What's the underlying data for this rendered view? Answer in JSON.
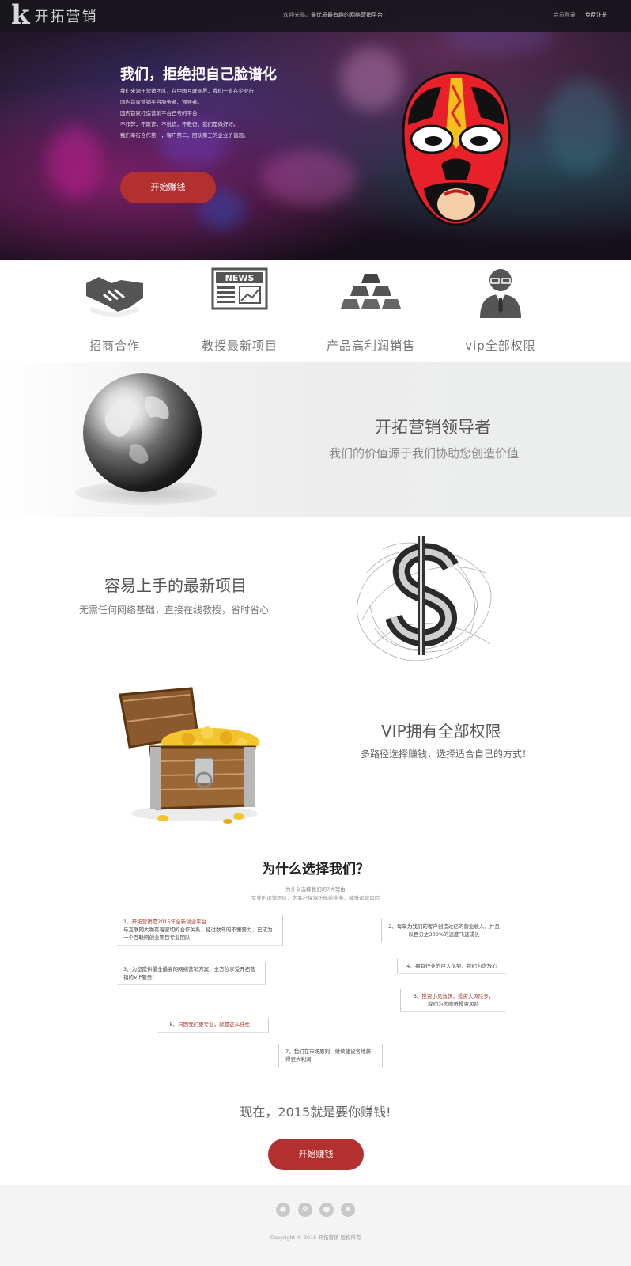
{
  "header": {
    "logo_letter": "k",
    "logo_text": "开拓营销",
    "welcome_prefix": "欢迎光临，",
    "welcome_text": "最优质最有趣的网络营销平台！",
    "login_label": "会员登录",
    "register_label": "免费注册"
  },
  "hero": {
    "title": "我们，拒绝把自己脸谱化",
    "lines": [
      "我们来源于营销团队，在中国互联网界，我们一直在企业行",
      "国内首家营销平台服务者、领导者。",
      "国内首家打造营销平台已号的平台",
      "不作弊，不欺诈，不说谎，不敷衍，我们是做好好。",
      "我们奉行合作第一，客户第二，团队第三的企业价值观。"
    ],
    "button": "开始赚钱"
  },
  "features": [
    {
      "label": "招商合作",
      "icon": "handshake-icon"
    },
    {
      "label": "教授最新项目",
      "icon": "news-icon",
      "icon_text": "NEWS"
    },
    {
      "label": "产品高利润销售",
      "icon": "gold-bars-icon"
    },
    {
      "label": "vip全部权限",
      "icon": "businessman-icon"
    }
  ],
  "leader": {
    "title": "开拓营销领导者",
    "subtitle": "我们的价值源于我们协助您创造价值"
  },
  "easy": {
    "title": "容易上手的最新项目",
    "subtitle": "无需任何网络基础，直接在线教授，省时省心"
  },
  "vip": {
    "title": "VIP拥有全部权限",
    "subtitle": "多路径选择赚钱，选择适合自己的方式！"
  },
  "why": {
    "title": "为什么选择我们？",
    "subtitle1": "为什么选择我们的7大理由",
    "subtitle2": "专业的运营团队，为客户保驾护航的业务，降低运营风险",
    "reasons": [
      {
        "prefix": "1、",
        "highlight": "开拓营销是2015年全新创业平台",
        "text": "与互联网大咖有着密切的合作关系，经过数年的不懈努力，已成为一个互联网创业项目专业团队"
      },
      {
        "prefix": "2、",
        "highlight": "",
        "text": "每年为我们的客户创造过亿的营业收入，并且以百分之300%的速度飞速成长"
      },
      {
        "prefix": "3、",
        "highlight": "",
        "text": "为您提供最全最高的网络营销方案，全方位享受开拓营销的VIP服务！"
      },
      {
        "prefix": "4、",
        "highlight": "",
        "text": "拥有行业的巨大优势，我们为您放心"
      },
      {
        "prefix": "6、",
        "highlight": "投资小见效快，投资大风险多，",
        "text": "我们为您降低投资风险"
      },
      {
        "prefix": "5、",
        "highlight": "只因我们更专业，就是这么任性！",
        "text": ""
      },
      {
        "prefix": "7、",
        "highlight": "",
        "text": "我们在市场原则，继续建设各地获得更大利润"
      }
    ]
  },
  "cta": {
    "text": "现在，2015就是要你赚钱!",
    "button": "开始赚钱"
  },
  "footer": {
    "social": [
      "weibo-icon",
      "wechat-icon",
      "qq-icon",
      "star-icon"
    ],
    "copyright": "Copyright © 2015 开拓营销 版权所有"
  },
  "colors": {
    "accent": "#b2312e",
    "header_bg": "#19161c",
    "footer_bg": "#f4f4f4"
  }
}
